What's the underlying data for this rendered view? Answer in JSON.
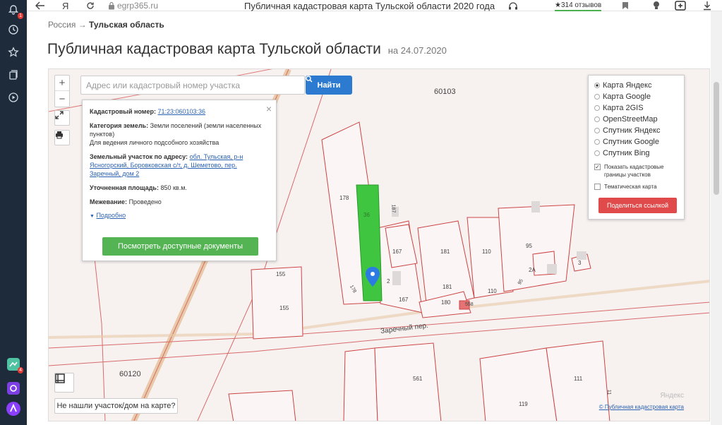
{
  "browser": {
    "url": "egrp365.ru",
    "tab_title": "Публичная кадастровая карта Тульской области 2020 года",
    "reviews": "★314 отзывов",
    "yandex_letter": "Я"
  },
  "sidebar": {
    "notifications_badge": "1",
    "app_badge": "4"
  },
  "breadcrumb": {
    "root": "Россия",
    "arrow": "→",
    "current": "Тульская область"
  },
  "page": {
    "title": "Публичная кадастровая карта Тульской области",
    "date": "на 24.07.2020"
  },
  "search": {
    "placeholder": "Адрес или кадастровый номер участка",
    "button": "Найти"
  },
  "info": {
    "cad_label": "Кадастровый номер:",
    "cad_value": "71:23:060103:36",
    "cat_label": "Категория земель:",
    "cat_value": "Земли поселений (земли населенных пунктов)",
    "use_value": "Для ведения личного подсобного хозяйства",
    "addr_label": "Земельный участок по адресу:",
    "addr_value": "обл. Тульская, р-н Ясногорский, Боровковская с/т, д. Шеметово, пер. Заречный, дом 2",
    "area_label": "Уточненная площадь:",
    "area_value": "850 кв.м.",
    "survey_label": "Межевание:",
    "survey_value": "Проведено",
    "more": "Подробно",
    "docs_button": "Посмотреть доступные документы"
  },
  "layers": {
    "options": [
      "Карта Яндекс",
      "Карта Google",
      "Карта 2GIS",
      "OpenStreetMap",
      "Спутник Яндекс",
      "Спутник Google",
      "Спутник Bing"
    ],
    "selected": "Карта Яндекс",
    "show_borders": "Показать кадастровые границы участков",
    "thematic": "Тематическая карта",
    "share": "Поделиться ссылкой"
  },
  "map": {
    "zones": [
      "60103",
      "60120"
    ],
    "street": "Заречный пер.",
    "plots": [
      "178",
      "36",
      "187",
      "167",
      "181",
      "110",
      "95",
      "2А",
      "3",
      "155",
      "155",
      "2",
      "178",
      "167",
      "181",
      "180",
      "110",
      "558",
      "95",
      "561",
      "111",
      "119",
      "11"
    ],
    "notfound": "Не нашли участок/дом на карте?",
    "yandex": "Яндекс",
    "copyright": "© Публичная кадастровая карта"
  }
}
